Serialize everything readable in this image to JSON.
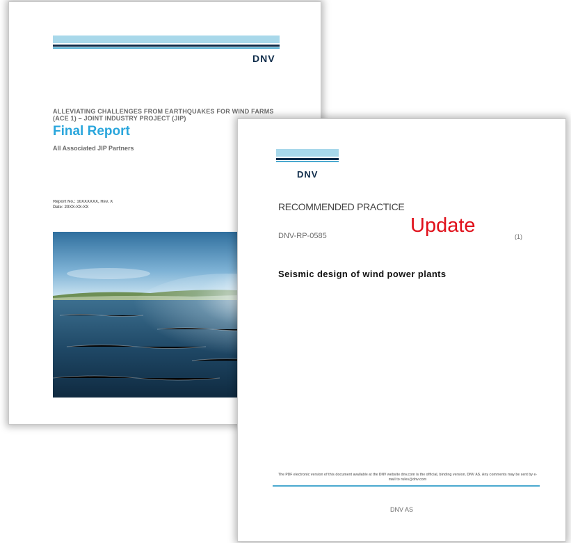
{
  "report": {
    "logo": "DNV",
    "subtitle": "ALLEVIATING CHALLENGES FROM EARTHQUAKES FOR WIND FARMS (ACE 1) – JOINT INDUSTRY PROJECT (JIP)",
    "title": "Final Report",
    "partners": "All Associated JIP Partners",
    "meta_line1": "Report No.: 10XXXXXX, Rev. X",
    "meta_line2": "Date: 20XX-XX-XX",
    "photo": "sea-horizon-photo"
  },
  "rp": {
    "logo": "DNV",
    "doc_type": "RECOMMENDED PRACTICE",
    "code": "DNV-RP-0585",
    "edition": "(1)",
    "title": "Seismic design of wind power plants",
    "footer_note": "The PDF electronic version of this document available at the DNV website dnv.com is the official, binding version. DNV AS. Any comments may be sent by e-mail to rules@dnv.com",
    "publisher": "DNV AS"
  },
  "overlay": {
    "stamp": "Update"
  },
  "colors": {
    "brand_navy": "#0f2c4a",
    "brand_light": "#a8d8ea",
    "title_blue": "#2aa6dc",
    "stamp_red": "#e0101a"
  }
}
